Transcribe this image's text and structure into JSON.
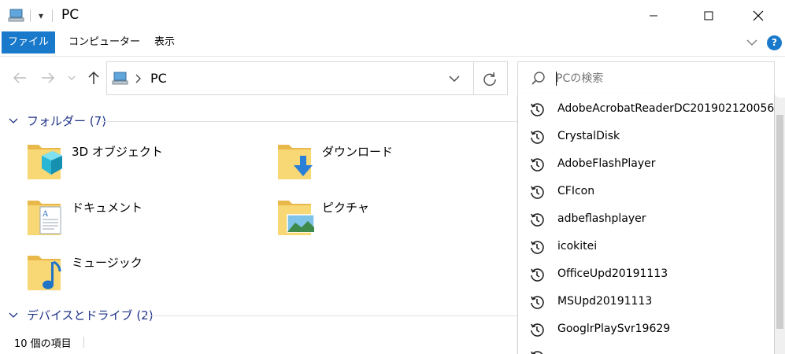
{
  "titlebar": {
    "title": "PC",
    "qa_arrow": "▾",
    "icons": {
      "app": "pc-icon",
      "minimize": "minimize-icon",
      "maximize": "maximize-icon",
      "close": "close-icon"
    }
  },
  "ribbon": {
    "tabs": [
      {
        "label": "ファイル",
        "active": true
      },
      {
        "label": "コンピューター",
        "active": false
      },
      {
        "label": "表示",
        "active": false
      }
    ],
    "help_label": "?"
  },
  "address": {
    "path_text": "PC"
  },
  "search": {
    "placeholder": "PCの検索",
    "value": ""
  },
  "sections": {
    "folders": {
      "label": "フォルダー (7)"
    },
    "devices": {
      "label": "デバイスとドライブ (2)"
    }
  },
  "folders": [
    {
      "name": "3D オブジェクト",
      "icon": "3d-objects-folder-icon"
    },
    {
      "name": "ダウンロード",
      "icon": "downloads-folder-icon"
    },
    {
      "name": "ドキュメント",
      "icon": "documents-folder-icon"
    },
    {
      "name": "ピクチャ",
      "icon": "pictures-folder-icon"
    },
    {
      "name": "ミュージック",
      "icon": "music-folder-icon"
    }
  ],
  "status": {
    "item_count": "10 個の項目"
  },
  "suggestions": [
    "AdobeAcrobatReaderDC201902120056",
    "CrystalDisk",
    "AdobeFlashPlayer",
    "CFIcon",
    "adbeflashplayer",
    "icokitei",
    "OfficeUpd20191113",
    "MSUpd20191113",
    "GooglrPlaySvr19629"
  ],
  "colors": {
    "accent": "#1979ca",
    "section_text": "#1e3287",
    "folder_yellow": "#f8d775"
  }
}
